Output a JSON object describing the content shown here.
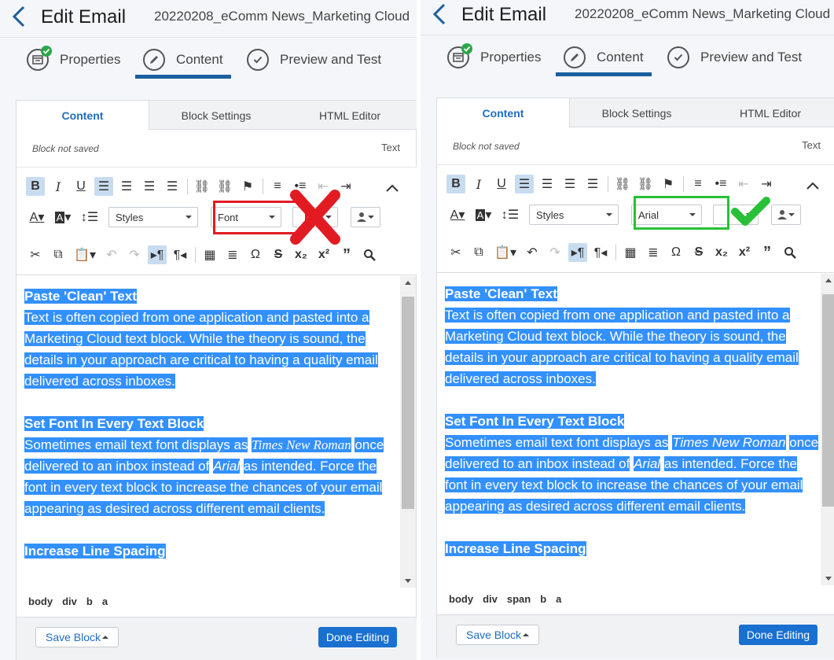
{
  "colors": {
    "accent": "#1f6cc4",
    "selection": "#3390ff",
    "wrong": "#e21b23",
    "right": "#27c037",
    "primary_button": "#1970d0"
  },
  "header": {
    "title": "Edit Email",
    "email_name": "20220208_eComm News_Marketing Cloud"
  },
  "steps": [
    {
      "label": "Properties",
      "icon": "properties-icon"
    },
    {
      "label": "Content",
      "icon": "pencil-icon"
    },
    {
      "label": "Preview and Test",
      "icon": "check-circle-icon"
    }
  ],
  "tabs": [
    "Content",
    "Block Settings",
    "HTML Editor"
  ],
  "status": "Block not saved",
  "block_type": "Text",
  "toolbar": {
    "styles_label": "Styles"
  },
  "content": {
    "h1": "Paste 'Clean' Text",
    "p1": "Text is often copied from one application and pasted into a Marketing Cloud text block. While the theory is sound, the details in your approach are critical to having a quality email delivered across inboxes.",
    "h2": "Set Font In Every Text Block",
    "p2a": "Sometimes email text font displays as",
    "p2_font1": "Times New Roman",
    "p2b": "once delivered to an inbox instead of",
    "p2_font2": "Arial",
    "p2c": "as intended. Force the font in every text block to increase the chances of your email appearing as desired across different email clients.",
    "h3": "Increase Line Spacing"
  },
  "footer": {
    "save_block": "Save Block",
    "done_editing": "Done Editing"
  },
  "left": {
    "font_value": "Font",
    "path": [
      "body",
      "div",
      "b",
      "a"
    ],
    "marker": "x-icon"
  },
  "right": {
    "font_value": "Arial",
    "path": [
      "body",
      "div",
      "span",
      "b",
      "a"
    ],
    "marker": "checkmark-icon"
  }
}
